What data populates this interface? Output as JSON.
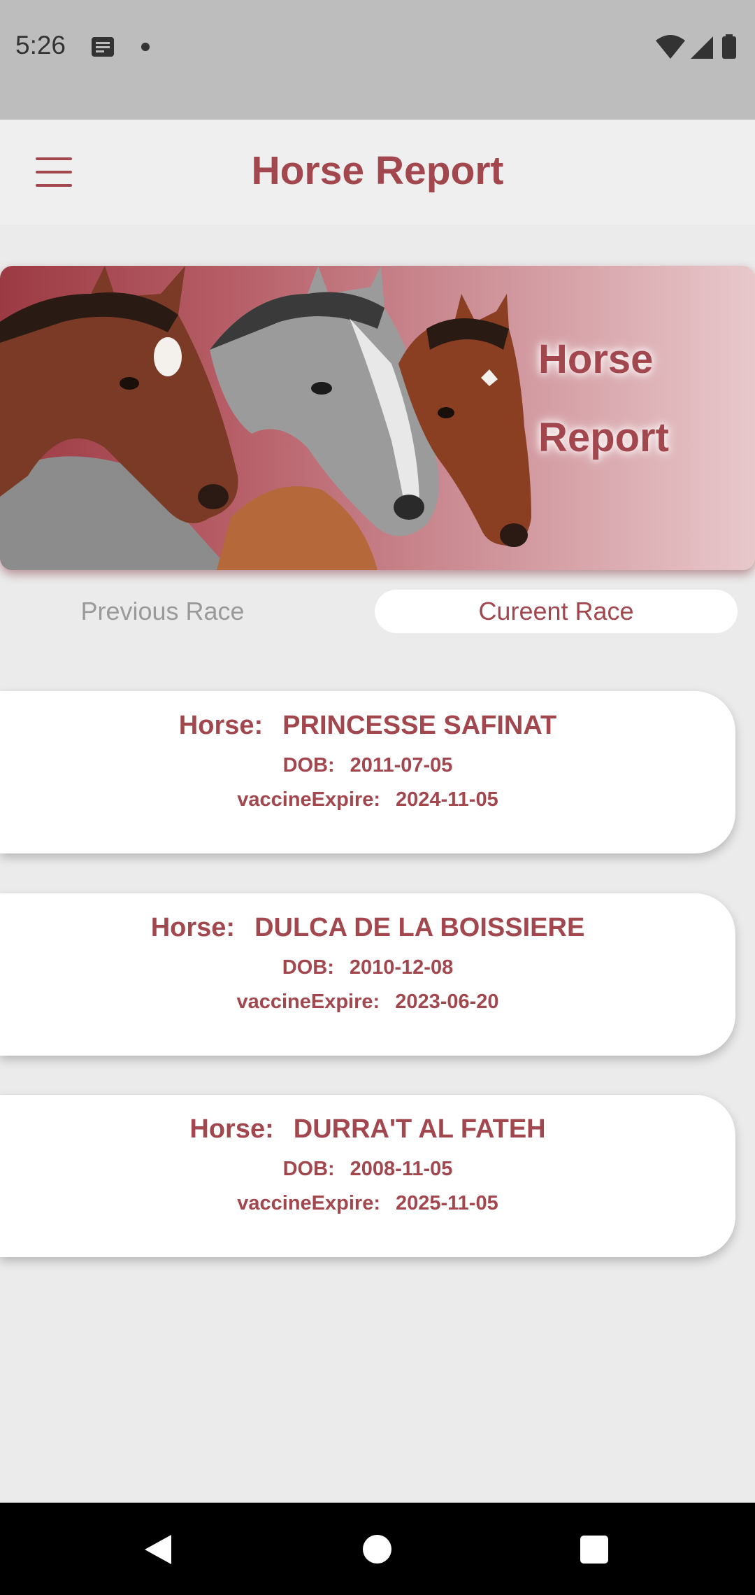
{
  "status_bar": {
    "time": "5:26"
  },
  "app_bar": {
    "title": "Horse Report"
  },
  "banner": {
    "line1": "Horse",
    "line2": "Report"
  },
  "tabs": [
    {
      "label": "Previous Race",
      "selected": false
    },
    {
      "label": "Cureent Race",
      "selected": true
    }
  ],
  "labels": {
    "horse": "Horse:",
    "dob": "DOB:",
    "vaccine": "vaccineExpire:"
  },
  "horses": [
    {
      "name": "PRINCESSE SAFINAT",
      "dob": "2011-07-05",
      "vaccine_expire": "2024-11-05"
    },
    {
      "name": "DULCA DE LA BOISSIERE",
      "dob": "2010-12-08",
      "vaccine_expire": "2023-06-20"
    },
    {
      "name": "DURRA'T AL FATEH",
      "dob": "2008-11-05",
      "vaccine_expire": "2025-11-05"
    }
  ],
  "colors": {
    "accent": "#a3474e",
    "background": "#ebebeb",
    "card": "#ffffff"
  }
}
